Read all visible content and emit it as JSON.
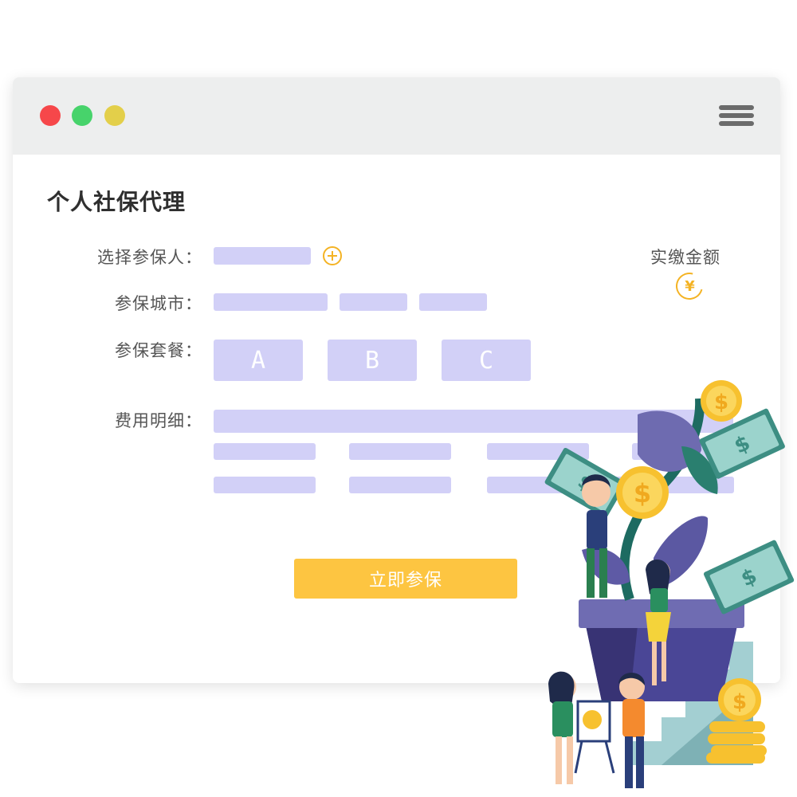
{
  "form": {
    "title": "个人社保代理",
    "insured_label": "选择参保人：",
    "city_label": "参保城市：",
    "package_label": "参保套餐：",
    "packages": [
      "A",
      "B",
      "C"
    ],
    "detail_label": "费用明细：",
    "amount_label": "实缴金额",
    "yen_symbol": "¥",
    "submit_label": "立即参保"
  },
  "colors": {
    "placeholder_bar": "#d2d0f7",
    "accent": "#fdc541",
    "icon_accent": "#f4b324",
    "titlebar": "#edeeee"
  }
}
